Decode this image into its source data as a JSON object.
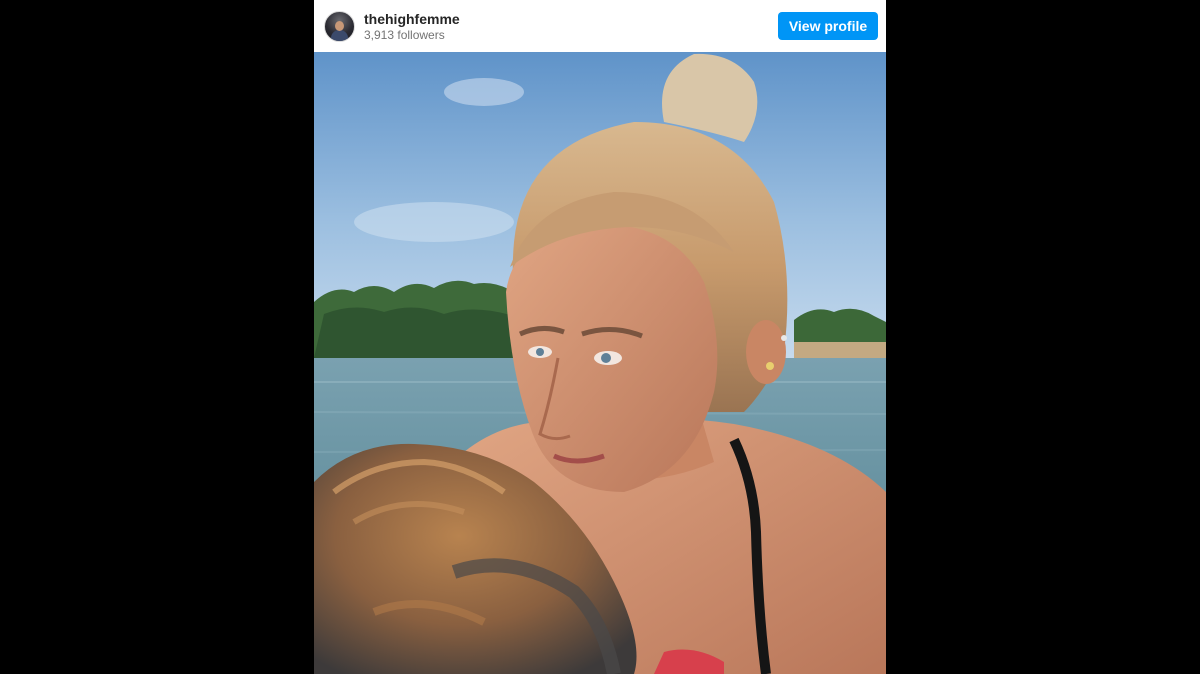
{
  "embed": {
    "account": {
      "username": "thehighfemme",
      "followers": "3,913 followers",
      "avatar_icon": "profile-avatar"
    },
    "actions": {
      "view_profile_label": "View profile"
    },
    "colors": {
      "accent": "#0095f6",
      "username": "#262626",
      "secondary_text": "#737373",
      "backdrop": "#000000"
    }
  }
}
